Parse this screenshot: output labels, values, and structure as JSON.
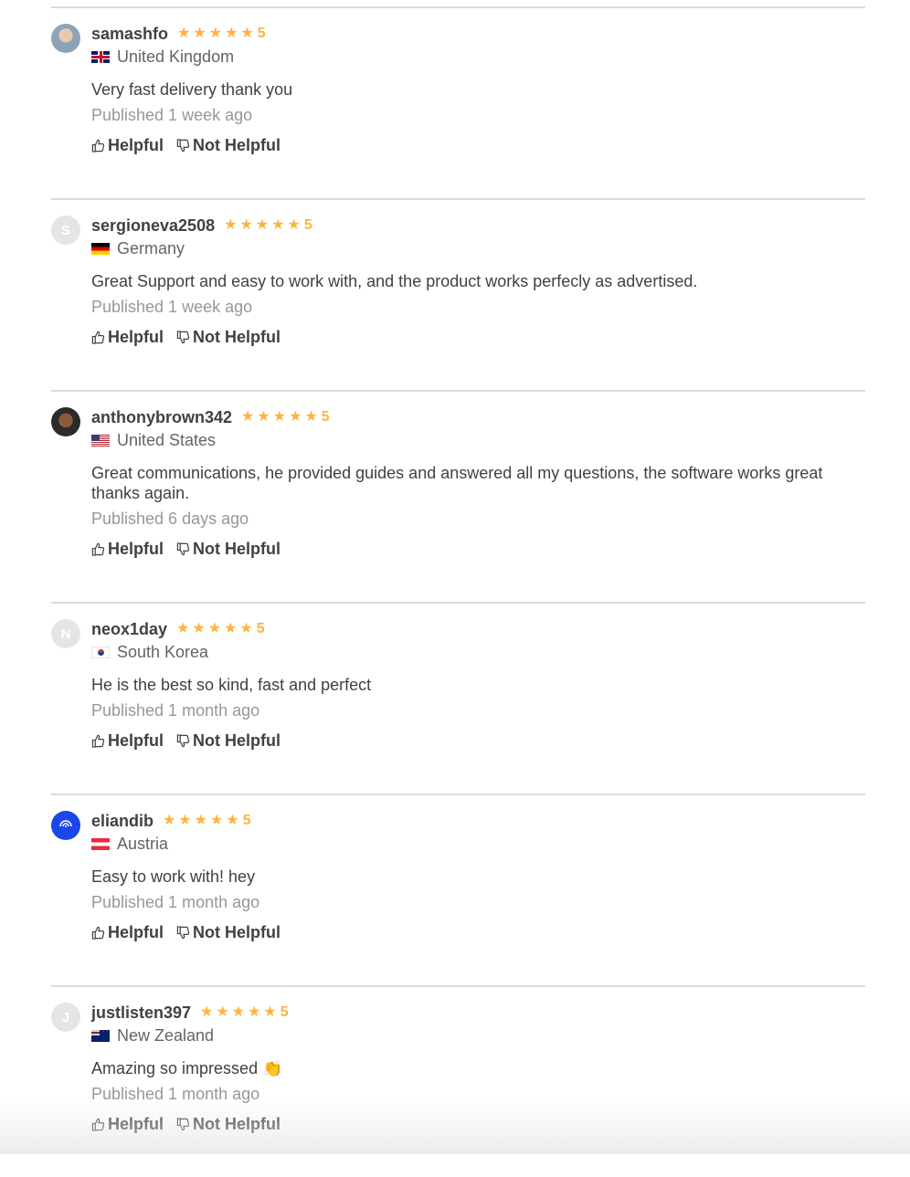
{
  "labels": {
    "helpful": "Helpful",
    "not_helpful": "Not Helpful"
  },
  "colors": {
    "star": "#ffb33e",
    "divider": "#dadbdd",
    "text": "#404145",
    "muted": "#95979d"
  },
  "reviews": [
    {
      "username": "samashfo",
      "rating": "5",
      "country": "United Kingdom",
      "flag": "flag-gb",
      "avatar": "photo",
      "text": "Very fast delivery thank you",
      "published": "Published 1 week ago"
    },
    {
      "username": "sergioneva2508",
      "rating": "5",
      "country": "Germany",
      "flag": "flag-de",
      "avatar": "S",
      "text": "Great Support and easy to work with, and the product works perfecly as advertised.",
      "published": "Published 1 week ago"
    },
    {
      "username": "anthonybrown342",
      "rating": "5",
      "country": "United States",
      "flag": "flag-us",
      "avatar": "photo",
      "text": "Great communications, he provided guides and answered all my questions, the software works great thanks again.",
      "published": "Published 6 days ago"
    },
    {
      "username": "neox1day",
      "rating": "5",
      "country": "South Korea",
      "flag": "flag-kr",
      "avatar": "N",
      "text": "He is the best so kind, fast and perfect",
      "published": "Published 1 month ago"
    },
    {
      "username": "eliandib",
      "rating": "5",
      "country": "Austria",
      "flag": "flag-at",
      "avatar": "logo",
      "text": "Easy to work with! hey",
      "published": "Published 1 month ago"
    },
    {
      "username": "justlisten397",
      "rating": "5",
      "country": "New Zealand",
      "flag": "flag-nz",
      "avatar": "J",
      "text": "Amazing so impressed 👏",
      "published": "Published 1 month ago"
    }
  ]
}
